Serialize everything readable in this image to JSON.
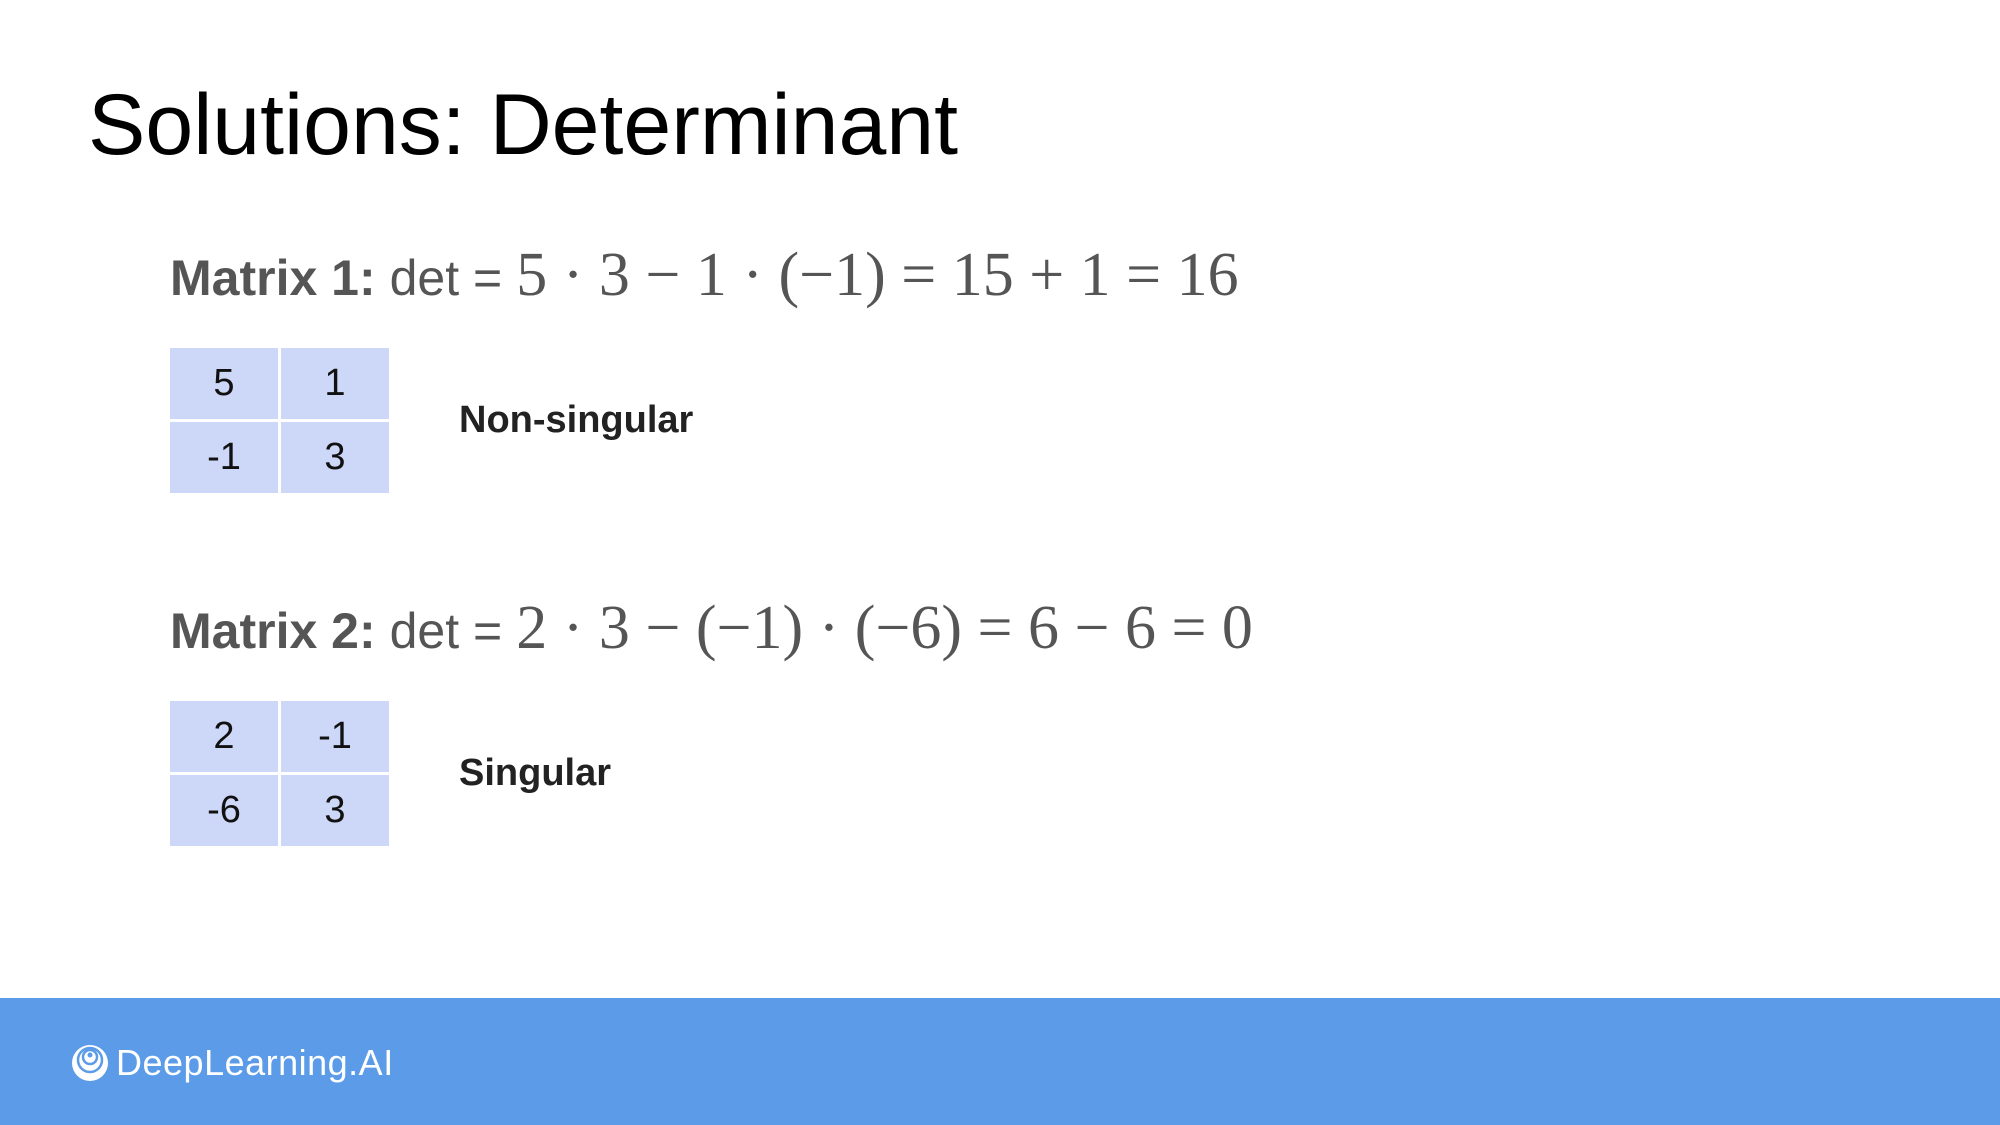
{
  "slide": {
    "title": "Solutions: Determinant"
  },
  "problems": [
    {
      "label": "Matrix 1:",
      "det_prefix": "det =",
      "formula": "5 · 3 − 1 · (−1) = 15 + 1 = 16",
      "matrix": [
        [
          "5",
          "1"
        ],
        [
          "-1",
          "3"
        ]
      ],
      "verdict": "Non-singular"
    },
    {
      "label": "Matrix 2:",
      "det_prefix": "det =",
      "formula": "2 · 3 − (−1) · (−6) = 6 − 6 = 0",
      "matrix": [
        [
          "2",
          "-1"
        ],
        [
          "-6",
          "3"
        ]
      ],
      "verdict": "Singular"
    }
  ],
  "footer": {
    "brand": "DeepLearning.AI",
    "icon": "deeplearning-logo-icon"
  },
  "colors": {
    "matrix_cell": "#cdd7f7",
    "footer_bar": "#5b9be8",
    "text_gray": "#555555"
  }
}
